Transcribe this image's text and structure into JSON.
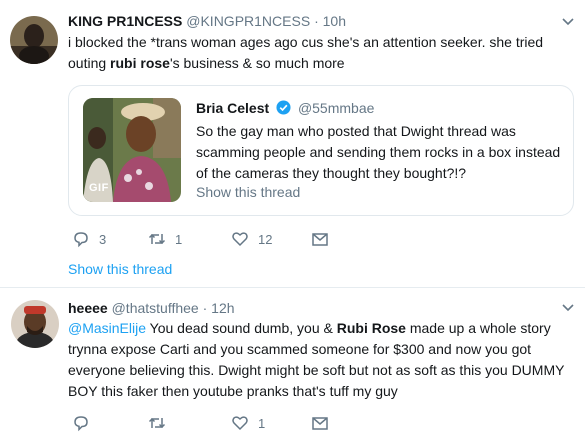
{
  "tweet1": {
    "name": "KING PR1NCESS",
    "handle": "@KINGPR1NCESS",
    "dot": "·",
    "time": "10h",
    "text_before": "i blocked the *trans woman ages ago cus she's an attention seeker. she tried outing ",
    "text_bold": "rubi rose",
    "text_after": "'s business & so much more",
    "quote": {
      "name": "Bria Celest",
      "handle": "@55mmbae",
      "text": "So the gay man who posted that Dwight thread was scamming people and sending them rocks in a box instead of the cameras they thought they bought?!?",
      "gif_label": "GIF",
      "show_thread": "Show this thread"
    },
    "replies": "3",
    "retweets": "1",
    "likes": "12",
    "show_thread": "Show this thread"
  },
  "tweet2": {
    "name": "heeee",
    "handle": "@thatstuffhee",
    "dot": "·",
    "time": "12h",
    "mention": "@MasinElije",
    "text_a": " You dead sound dumb, you & ",
    "text_bold": "Rubi Rose",
    "text_b": " made up a whole story trynna expose Carti and you scammed someone for $300 and now you got everyone believing this. Dwight might be soft but not as soft as this you DUMMY BOY this faker then youtube pranks that's tuff my guy",
    "likes": "1"
  },
  "colors": {
    "accent": "#1da1f2",
    "muted": "#657786",
    "border": "#e1e8ed"
  },
  "icons": [
    "reply-icon",
    "retweet-icon",
    "like-icon",
    "dm-icon",
    "chevron-down-icon",
    "verified-badge-icon"
  ]
}
